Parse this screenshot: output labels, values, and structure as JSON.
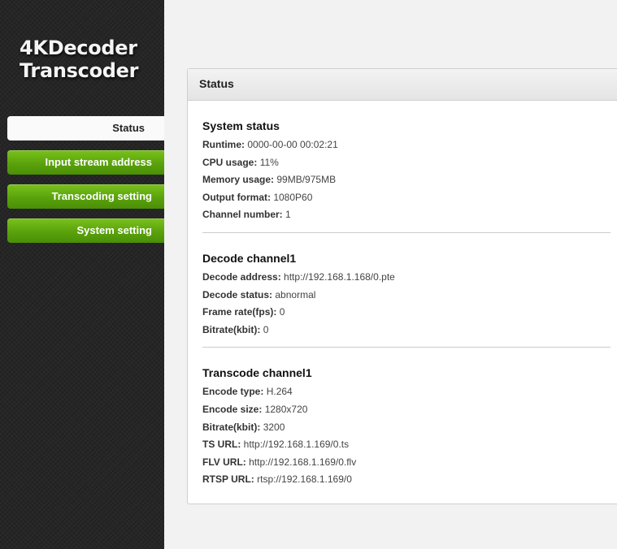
{
  "logo": {
    "line1": "4KDecoder",
    "line2": "Transcoder"
  },
  "nav": {
    "items": [
      {
        "label": "Status",
        "active": true
      },
      {
        "label": "Input stream address",
        "active": false
      },
      {
        "label": "Transcoding setting",
        "active": false
      },
      {
        "label": "System setting",
        "active": false
      }
    ]
  },
  "panel": {
    "title": "Status"
  },
  "system_status": {
    "title": "System status",
    "rows": [
      {
        "label": "Runtime:",
        "value": "0000-00-00 00:02:21"
      },
      {
        "label": "CPU usage:",
        "value": "11%"
      },
      {
        "label": "Memory usage:",
        "value": "99MB/975MB"
      },
      {
        "label": "Output format:",
        "value": "1080P60"
      },
      {
        "label": "Channel number:",
        "value": "1"
      }
    ]
  },
  "decode_channel": {
    "title": "Decode channel1",
    "rows": [
      {
        "label": "Decode address:",
        "value": "http://192.168.1.168/0.pte"
      },
      {
        "label": "Decode status:",
        "value": "abnormal"
      },
      {
        "label": "Frame rate(fps):",
        "value": "0"
      },
      {
        "label": "Bitrate(kbit):",
        "value": "0"
      }
    ]
  },
  "transcode_channel": {
    "title": "Transcode channel1",
    "rows": [
      {
        "label": "Encode type:",
        "value": "H.264"
      },
      {
        "label": "Encode size:",
        "value": "1280x720"
      },
      {
        "label": "Bitrate(kbit):",
        "value": "3200"
      },
      {
        "label": "TS URL:",
        "value": "http://192.168.1.169/0.ts"
      },
      {
        "label": "FLV URL:",
        "value": "http://192.168.1.169/0.flv"
      },
      {
        "label": "RTSP URL:",
        "value": "rtsp://192.168.1.169/0"
      }
    ]
  }
}
